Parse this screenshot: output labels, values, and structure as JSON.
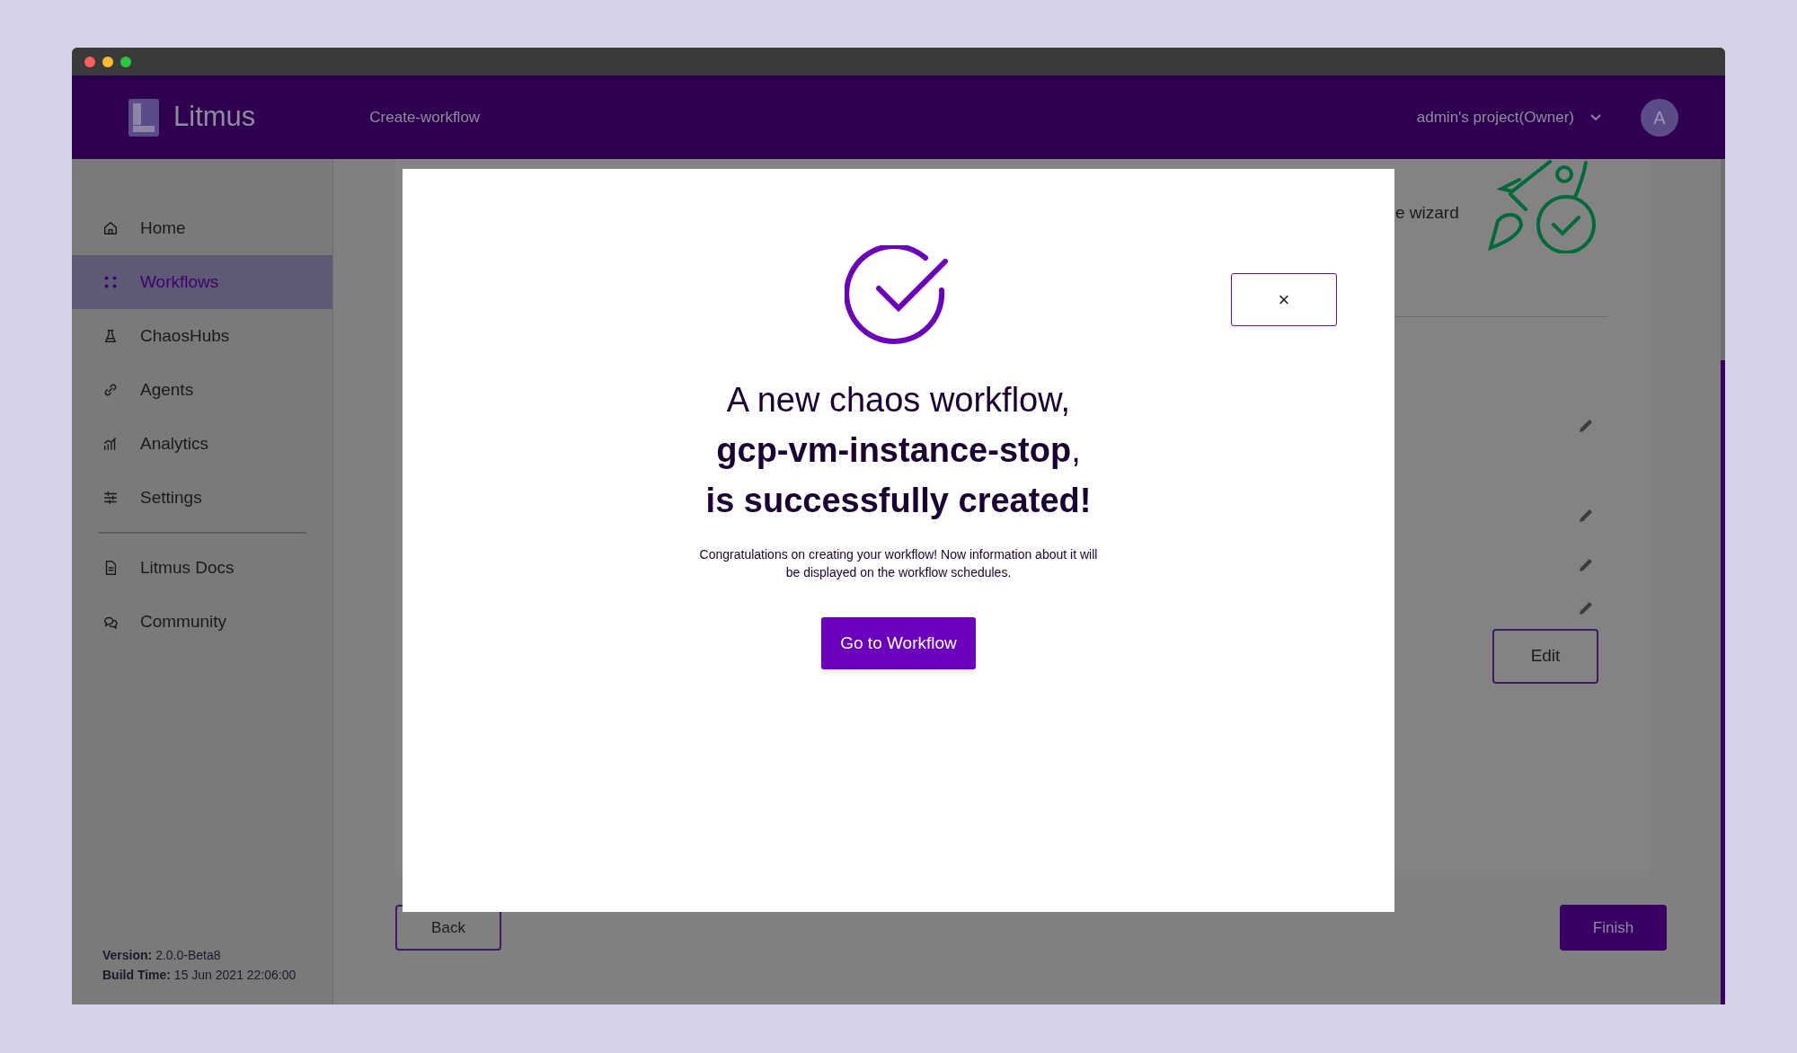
{
  "header": {
    "brand": "Litmus",
    "breadcrumb": "Create-workflow",
    "project": "admin's project(Owner)",
    "avatar": "A"
  },
  "sidebar": {
    "items": [
      {
        "label": "Home",
        "selected": false
      },
      {
        "label": "Workflows",
        "selected": true
      },
      {
        "label": "ChaosHubs",
        "selected": false
      },
      {
        "label": "Agents",
        "selected": false
      },
      {
        "label": "Analytics",
        "selected": false
      },
      {
        "label": "Settings",
        "selected": false
      }
    ],
    "links": [
      {
        "label": "Litmus Docs"
      },
      {
        "label": "Community"
      }
    ],
    "version": "**Version:** 2.0.0-Beta8",
    "build_time": "**Build Time:** 15 Jun 2021 22:06:00"
  },
  "background": {
    "wizard_text": "e wizard",
    "edit_button": "Edit",
    "back_button": "Back",
    "finish_button": "Finish"
  },
  "modal": {
    "close": "×",
    "title_lines": [
      "A new chaos workflow,",
      "**gcp-vm-instance-stop**,",
      "**is successfully created!**"
    ],
    "message": "Congratulations on creating your workflow! Now information about it will be displayed on the workflow schedules.",
    "button": "Go to Workflow"
  }
}
